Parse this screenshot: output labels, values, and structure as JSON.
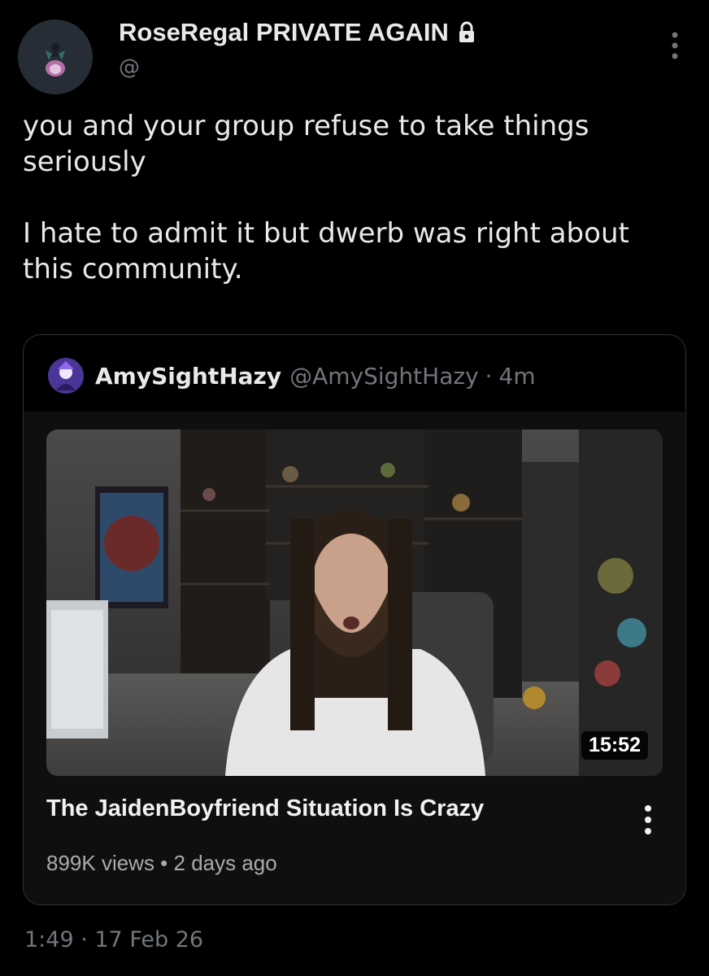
{
  "author": {
    "display_name": "RoseRegal PRIVATE AGAIN",
    "handle": "@",
    "avatar_icon": "avatar-image",
    "lock_icon": "lock-icon"
  },
  "tweet": {
    "text": "you and your group refuse to take things\nseriously\n\nI hate to admit it but dwerb was right about\nthis community."
  },
  "quote": {
    "name": "AmySightHazy",
    "handle": "@AmySightHazy",
    "separator": "·",
    "time": "4m",
    "video": {
      "duration": "15:52",
      "title": "The JaidenBoyfriend Situation Is Crazy",
      "meta": "899K views • 2 days ago"
    }
  },
  "footer": {
    "timestamp": "1:49 · 17 Feb 26"
  },
  "colors": {
    "background": "#000000",
    "text": "#e7e9ea",
    "muted": "#71767b",
    "border": "#2f3336"
  }
}
